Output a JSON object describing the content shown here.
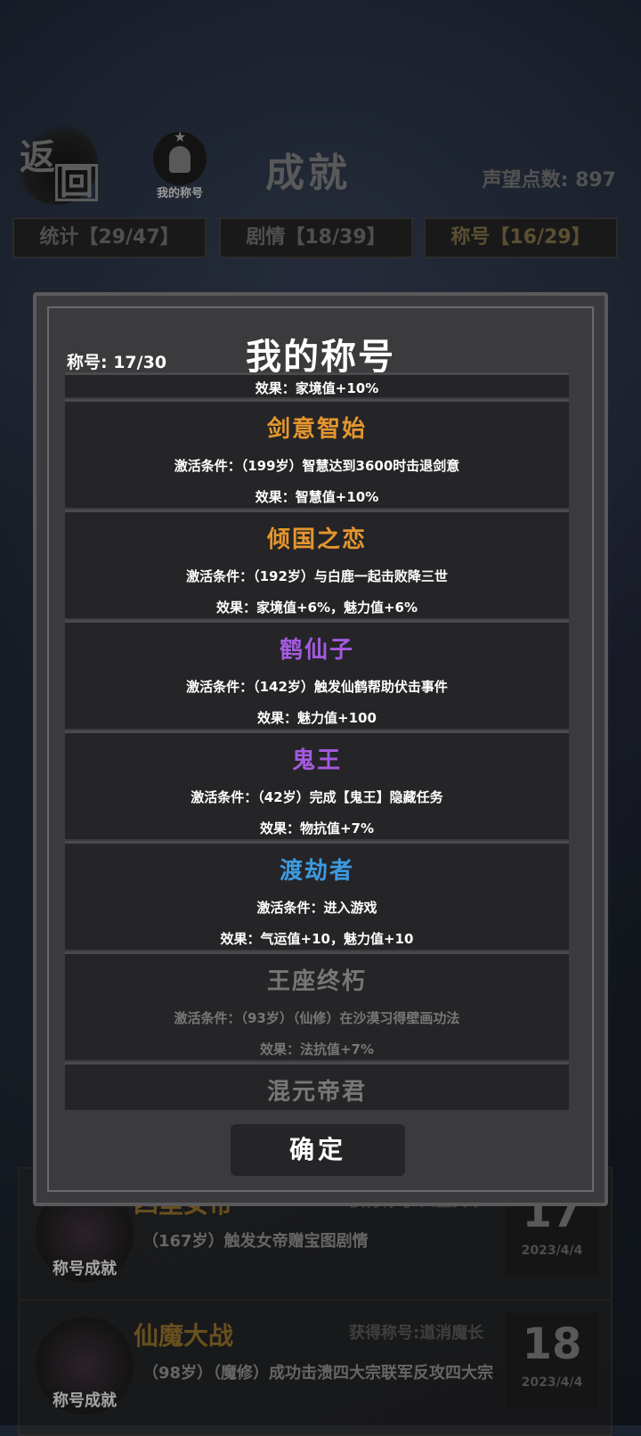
{
  "header": {
    "back_char1": "返",
    "back_char2": "回",
    "title_button_label": "我的称号",
    "page_title": "成就",
    "prestige": "声望点数: 897"
  },
  "tabs": [
    {
      "label": "统计【29/47】"
    },
    {
      "label": "剧情【18/39】"
    },
    {
      "label": "称号【16/29】"
    }
  ],
  "background_list": [
    {
      "name": "四里女帝",
      "reward": "获得称号:四里女帝",
      "desc": "（167岁）触发女帝赠宝图剧情",
      "badge": "称号成就",
      "number": "17",
      "date": "2023/4/4"
    },
    {
      "name": "仙魔大战",
      "reward": "获得称号:道消魔长",
      "desc": "（98岁）（魔修）成功击溃四大宗联军反攻四大宗",
      "badge": "称号成就",
      "number": "18",
      "date": "2023/4/4"
    }
  ],
  "modal": {
    "title": "我的称号",
    "count": "称号: 17/30",
    "confirm": "确定",
    "top_partial_effect": "效果：家境值+10%",
    "titles": [
      {
        "name": "剑意智始",
        "color": "#e5962e",
        "condition": "激活条件：（199岁）智慧达到3600时击退剑意",
        "effect": "效果：智慧值+10%",
        "locked": false
      },
      {
        "name": "倾国之恋",
        "color": "#e5962e",
        "condition": "激活条件：（192岁）与白鹿一起击败降三世",
        "effect": "效果：家境值+6%，魅力值+6%",
        "locked": false
      },
      {
        "name": "鹤仙子",
        "color": "#a45ae0",
        "condition": "激活条件：（142岁）触发仙鹤帮助伏击事件",
        "effect": "效果：魅力值+100",
        "locked": false
      },
      {
        "name": "鬼王",
        "color": "#a45ae0",
        "condition": "激活条件：（42岁）完成【鬼王】隐藏任务",
        "effect": "效果：物抗值+7%",
        "locked": false
      },
      {
        "name": "渡劫者",
        "color": "#3d9ae0",
        "condition": "激活条件：进入游戏",
        "effect": "效果：气运值+10，魅力值+10",
        "locked": false
      },
      {
        "name": "王座终朽",
        "color": "#777777",
        "condition": "激活条件：（93岁）（仙修）在沙漠习得壁画功法",
        "effect": "效果：法抗值+7%",
        "locked": true
      },
      {
        "name": "混元帝君",
        "color": "#999999",
        "condition": "",
        "effect": "",
        "locked": true
      }
    ]
  }
}
